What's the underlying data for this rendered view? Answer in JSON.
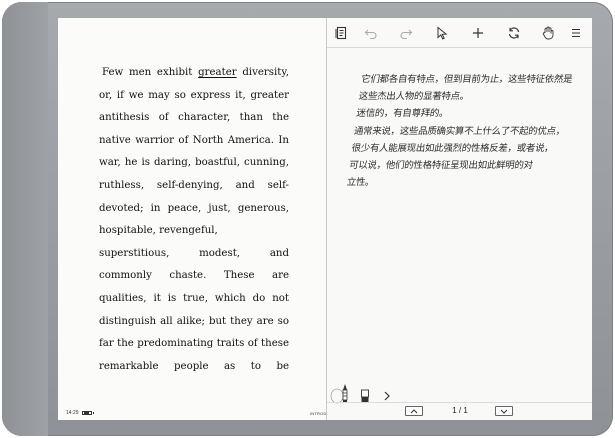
{
  "book": {
    "lines": [
      "Few men exhibit greater diversity,",
      "or, if we may so express it, greater",
      "antithesis of character, than the",
      "native warrior of North America. In",
      "war, he is daring, boastful, cunning,",
      "ruthless, self-denying, and self-",
      "devoted; in peace, just, generous,",
      "hospitable, revengeful,",
      "superstitious, modest, and",
      "commonly chaste. These are",
      "qualities, it is true, which do not",
      "distinguish all alike; but they are so",
      "far the predominating traits of these",
      "remarkable people as to be"
    ],
    "first_line_parts": {
      "before": "Few men exhibit ",
      "underlined": "greater",
      "after": " diversity,"
    }
  },
  "status": {
    "time": "14:29",
    "footer": "INTRODU"
  },
  "notes": {
    "handwriting": [
      "它们都各自有特点，但到目前为止，这些特征依然是",
      "这些杰出人物的显著特点。",
      "迷信的，有自尊拜的。",
      "通常来说，这些品质确实算不上什么了不起的优点，",
      "很少有人能展现出如此强烈的性格反差，或者说，",
      "可以说，他们的性格特征呈现出如此鲜明的对",
      "立性。"
    ]
  },
  "toolbar": {
    "icons": [
      "template-icon",
      "undo-icon",
      "redo-icon",
      "select-icon",
      "add-icon",
      "sync-icon",
      "hand-icon",
      "menu-icon"
    ]
  },
  "pager": {
    "label": "1 / 1"
  }
}
